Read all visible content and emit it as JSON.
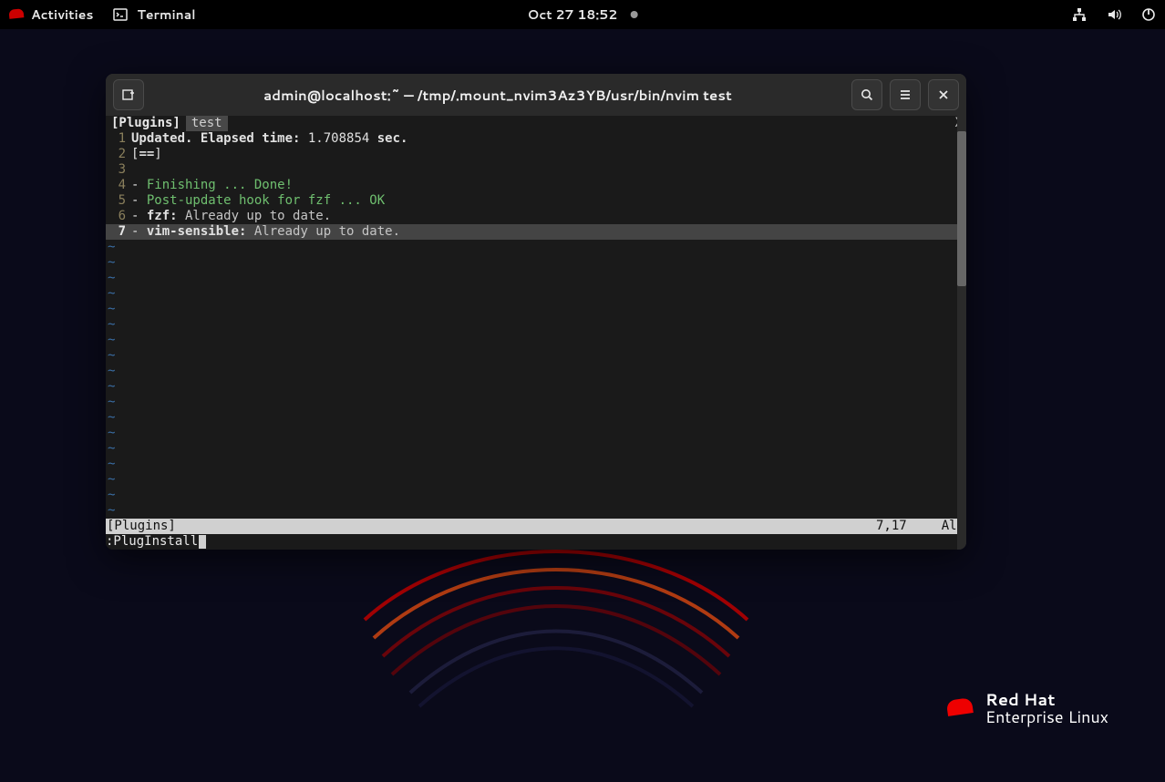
{
  "topbar": {
    "activities": "Activities",
    "app_label": "Terminal",
    "clock": "Oct 27  18:52"
  },
  "window": {
    "title": "admin@localhost:~ — /tmp/.mount_nvim3Az3YB/usr/bin/nvim test"
  },
  "vim": {
    "tabs": {
      "active": "[Plugins]",
      "other": " test ",
      "close": "X"
    },
    "lines": [
      {
        "n": "1",
        "current": false,
        "segments": [
          {
            "text": "Updated. Elapsed time:",
            "cls": "bold tw"
          },
          {
            "text": " 1.708854 ",
            "cls": "tw"
          },
          {
            "text": "sec.",
            "cls": "bold tw"
          }
        ]
      },
      {
        "n": "2",
        "current": false,
        "segments": [
          {
            "text": "[",
            "cls": "tw"
          },
          {
            "text": "==",
            "cls": "bold tw"
          },
          {
            "text": "]",
            "cls": "tw"
          }
        ]
      },
      {
        "n": "3",
        "current": false,
        "segments": [
          {
            "text": "",
            "cls": "tw"
          }
        ]
      },
      {
        "n": "4",
        "current": false,
        "segments": [
          {
            "text": "- ",
            "cls": "dash"
          },
          {
            "text": "Finishing ... Done!",
            "cls": "green"
          }
        ]
      },
      {
        "n": "5",
        "current": false,
        "segments": [
          {
            "text": "- ",
            "cls": "dash"
          },
          {
            "text": "Post-update hook for fzf ... OK",
            "cls": "green"
          }
        ]
      },
      {
        "n": "6",
        "current": false,
        "segments": [
          {
            "text": "- ",
            "cls": "dash"
          },
          {
            "text": "fzf:",
            "cls": "bold tw"
          },
          {
            "text": " Already up to date.",
            "cls": "gray"
          }
        ]
      },
      {
        "n": "7",
        "current": true,
        "segments": [
          {
            "text": "- ",
            "cls": "dash"
          },
          {
            "text": "vim-sensible:",
            "cls": "bold tw"
          },
          {
            "text": " Already up to date.",
            "cls": "gray"
          }
        ]
      }
    ],
    "tilde_count": 18,
    "status": {
      "left": "[Plugins]",
      "pos": "7,17",
      "pct": "All"
    },
    "cmdline": ":PlugInstall"
  },
  "branding": {
    "line1": "Red Hat",
    "line2": "Enterprise Linux"
  }
}
